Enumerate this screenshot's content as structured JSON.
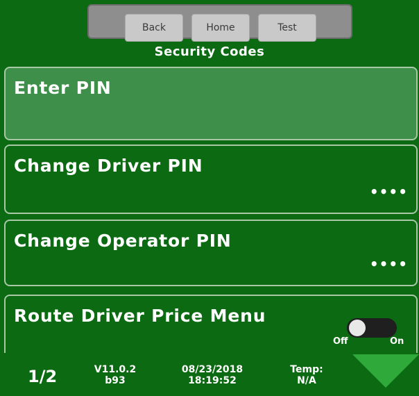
{
  "header": {
    "buttons": {
      "back": "Back",
      "home": "Home",
      "test": "Test"
    },
    "title": "Security Codes"
  },
  "menu": {
    "items": [
      {
        "label": "Enter PIN",
        "value": "",
        "selected": true
      },
      {
        "label": "Change Driver PIN",
        "value": "••••",
        "selected": false
      },
      {
        "label": "Change Operator PIN",
        "value": "••••",
        "selected": false
      },
      {
        "label": "Route Driver Price Menu",
        "value": "",
        "selected": false
      }
    ],
    "toggle": {
      "off_label": "Off",
      "on_label": "On",
      "state": "off"
    }
  },
  "status": {
    "page": "1/2",
    "version": "V11.0.2",
    "build": "b93",
    "date": "08/23/2018",
    "time": "18:19:52",
    "temp_label": "Temp:",
    "temp_value": "N/A"
  },
  "colors": {
    "background": "#0b6a12",
    "selected_row": "#3d8f4a",
    "nav_arrow": "#2faa3a"
  }
}
